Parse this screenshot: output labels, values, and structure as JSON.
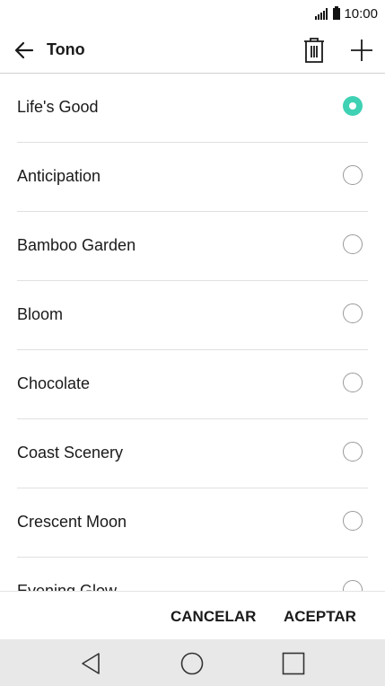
{
  "status_bar": {
    "time": "10:00"
  },
  "app_bar": {
    "title": "Tono"
  },
  "ringtones": [
    {
      "label": "Life's Good",
      "selected": true
    },
    {
      "label": "Anticipation",
      "selected": false
    },
    {
      "label": "Bamboo Garden",
      "selected": false
    },
    {
      "label": "Bloom",
      "selected": false
    },
    {
      "label": "Chocolate",
      "selected": false
    },
    {
      "label": "Coast Scenery",
      "selected": false
    },
    {
      "label": "Crescent Moon",
      "selected": false
    },
    {
      "label": "Evening Glow",
      "selected": false
    }
  ],
  "dialog": {
    "cancel_label": "CANCELAR",
    "accept_label": "ACEPTAR"
  },
  "colors": {
    "accent": "#3fd1b4",
    "nav_bar": "#e8e8e8"
  }
}
